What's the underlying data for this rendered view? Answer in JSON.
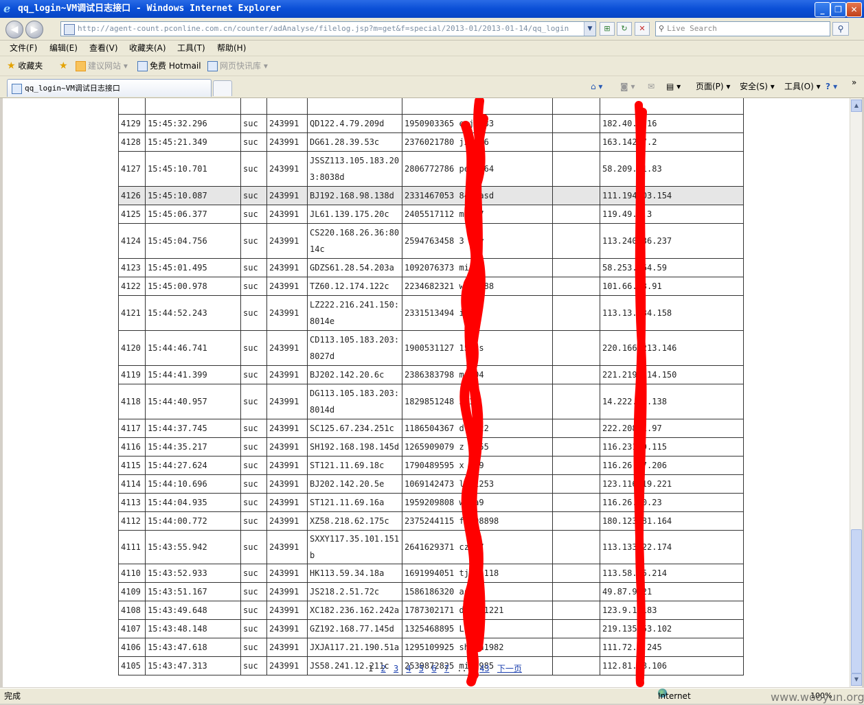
{
  "window": {
    "title": "qq_login~VM调试日志接口 - Windows Internet Explorer",
    "minimize_label": "_",
    "maximize_label": "❐",
    "close_label": "✕"
  },
  "nav": {
    "back_glyph": "◀",
    "forward_glyph": "▶",
    "url": "http://agent-count.pconline.com.cn/counter/adAnalyse/filelog.jsp?m=get&f=special/2013-01/2013-01-14/qq_login",
    "url_dropdown_glyph": "▼",
    "compat_glyph": "⊞",
    "refresh_glyph": "↻",
    "stop_glyph": "✕",
    "search_placeholder": "Live Search",
    "search_glyph": "⚲",
    "search_button_glyph": "⚲"
  },
  "menu": {
    "file": "文件(F)",
    "edit": "编辑(E)",
    "view": "查看(V)",
    "favorites": "收藏夹(A)",
    "tools": "工具(T)",
    "help": "帮助(H)"
  },
  "favbar": {
    "favorites": "收藏夹",
    "suggested_sites": "建议网站 ▾",
    "hotmail": "免费 Hotmail",
    "web_slices": "网页快讯库 ▾"
  },
  "tabs": {
    "active_title": "qq_login~VM调试日志接口"
  },
  "commandbar": {
    "home_glyph": "⌂ ▾",
    "feeds_glyph": "◙ ▾",
    "mail_glyph": "✉",
    "print_glyph": "▤ ▾",
    "page": "页面(P) ▾",
    "safety": "安全(S) ▾",
    "tools": "工具(O) ▾",
    "help_glyph": "? ▾",
    "more_glyph": "»"
  },
  "log": {
    "rows": [
      {
        "id": "4129",
        "time": "15:45:32.296",
        "status": "suc",
        "code": "243991",
        "src": "QD122.4.79.209d",
        "qq": "1950903365 esj  133",
        "blank": "",
        "ip": "182.40.   .16"
      },
      {
        "id": "4128",
        "time": "15:45:21.349",
        "status": "suc",
        "code": "243991",
        "src": "DG61.28.39.53c",
        "qq": "2376021780 jx   676",
        "blank": "",
        "ip": "163.142  7.2"
      },
      {
        "id": "4127",
        "time": "15:45:10.701",
        "status": "suc",
        "code": "243991",
        "src": "JSSZ113.105.183.203:8038d",
        "qq": "2806772786 pe   7564",
        "blank": "",
        "ip": "58.209.  1.83"
      },
      {
        "id": "4126",
        "time": "15:45:10.087",
        "status": "suc",
        "code": "243991",
        "src": "BJ192.168.98.138d",
        "qq": "2331467053 84   7asd",
        "blank": "",
        "ip": "111.194  03.154"
      },
      {
        "id": "4125",
        "time": "15:45:06.377",
        "status": "suc",
        "code": "243991",
        "src": "JL61.139.175.20c",
        "qq": "2405517112 mi   07",
        "blank": "",
        "ip": "119.49.  .3"
      },
      {
        "id": "4124",
        "time": "15:45:04.756",
        "status": "suc",
        "code": "243991",
        "src": "CS220.168.26.36:8014c",
        "qq": "2594763458 3   9zy",
        "blank": "",
        "ip": "113.240  36.237"
      },
      {
        "id": "4123",
        "time": "15:45:01.495",
        "status": "suc",
        "code": "243991",
        "src": "GDZS61.28.54.203a",
        "qq": "1092076373 mi   46",
        "blank": "",
        "ip": "58.253.  64.59"
      },
      {
        "id": "4122",
        "time": "15:45:00.978",
        "status": "suc",
        "code": "243991",
        "src": "TZ60.12.174.122c",
        "qq": "2234682321 w    ma188",
        "blank": "",
        "ip": "101.66.  3.91"
      },
      {
        "id": "4121",
        "time": "15:44:52.243",
        "status": "suc",
        "code": "243991",
        "src": "LZ222.216.241.150:8014e",
        "qq": "2331513494 i   16",
        "blank": "",
        "ip": "113.13.  34.158"
      },
      {
        "id": "4120",
        "time": "15:44:46.741",
        "status": "suc",
        "code": "243991",
        "src": "CD113.105.183.203:8027d",
        "qq": "1900531127 15   cs",
        "blank": "",
        "ip": "220.166  213.146"
      },
      {
        "id": "4119",
        "time": "15:44:41.399",
        "status": "suc",
        "code": "243991",
        "src": "BJ202.142.20.6c",
        "qq": "2386383798 mi   04",
        "blank": "",
        "ip": "221.219  114.150"
      },
      {
        "id": "4118",
        "time": "15:44:40.957",
        "status": "suc",
        "code": "243991",
        "src": "DG113.105.183.203:8014d",
        "qq": "1829851248 3   1a",
        "blank": "",
        "ip": "14.222.  1.138"
      },
      {
        "id": "4117",
        "time": "15:44:37.745",
        "status": "suc",
        "code": "243991",
        "src": "SC125.67.234.251c",
        "qq": "1186504367 d   1222",
        "blank": "",
        "ip": "222.208  1.97"
      },
      {
        "id": "4116",
        "time": "15:44:35.217",
        "status": "suc",
        "code": "243991",
        "src": "SH192.168.198.145d",
        "qq": "1265909079 z   8155",
        "blank": "",
        "ip": "116.231  9.115"
      },
      {
        "id": "4115",
        "time": "15:44:27.624",
        "status": "suc",
        "code": "243991",
        "src": "ST121.11.69.18c",
        "qq": "1790489595 x   629",
        "blank": "",
        "ip": "116.26.  7.206"
      },
      {
        "id": "4114",
        "time": "15:44:10.696",
        "status": "suc",
        "code": "243991",
        "src": "BJ202.142.20.5e",
        "qq": "1069142473 lz   1253",
        "blank": "",
        "ip": "123.116  19.221"
      },
      {
        "id": "4113",
        "time": "15:44:04.935",
        "status": "suc",
        "code": "243991",
        "src": "ST121.11.69.16a",
        "qq": "1959209808 wa   a9",
        "blank": "",
        "ip": "116.26.  0.23"
      },
      {
        "id": "4112",
        "time": "15:44:00.772",
        "status": "suc",
        "code": "243991",
        "src": "XZ58.218.62.175c",
        "qq": "2375244115 fj   98898",
        "blank": "",
        "ip": "180.123  81.164"
      },
      {
        "id": "4111",
        "time": "15:43:55.942",
        "status": "suc",
        "code": "243991",
        "src": "SXXY117.35.101.151b",
        "qq": "2641629371 cz   37",
        "blank": "",
        "ip": "113.133  22.174"
      },
      {
        "id": "4110",
        "time": "15:43:52.933",
        "status": "suc",
        "code": "243991",
        "src": "HK113.59.34.18a",
        "qq": "1691994051 tj   71118",
        "blank": "",
        "ip": "113.58.  5.214"
      },
      {
        "id": "4109",
        "time": "15:43:51.167",
        "status": "suc",
        "code": "243991",
        "src": "JS218.2.51.72c",
        "qq": "1586186320 as   35",
        "blank": "",
        "ip": "49.87.9  21"
      },
      {
        "id": "4108",
        "time": "15:43:49.648",
        "status": "suc",
        "code": "243991",
        "src": "XC182.236.162.242a",
        "qq": "1787302171 da   861221",
        "blank": "",
        "ip": "123.9.1   183"
      },
      {
        "id": "4107",
        "time": "15:43:48.148",
        "status": "suc",
        "code": "243991",
        "src": "GZ192.168.77.145d",
        "qq": "1325468895 LO   56",
        "blank": "",
        "ip": "219.135  53.102"
      },
      {
        "id": "4106",
        "time": "15:43:47.618",
        "status": "suc",
        "code": "243991",
        "src": "JXJA117.21.190.51a",
        "qq": "1295109925 sh   ua1982",
        "blank": "",
        "ip": "111.72.  .245"
      },
      {
        "id": "4105",
        "time": "15:43:47.313",
        "status": "suc",
        "code": "243991",
        "src": "JS58.241.12.211c",
        "qq": "2539872825 mi   6985",
        "blank": "",
        "ip": "112.81.  8.106"
      }
    ]
  },
  "pager": {
    "current": "1",
    "pages": [
      "2",
      "3",
      "4",
      "5",
      "6",
      "7"
    ],
    "ellipsis": "...",
    "last": "43",
    "next": "下一页"
  },
  "scroll": {
    "up_glyph": "▲",
    "down_glyph": "▼"
  },
  "status": {
    "left": "完成",
    "zone": "Internet",
    "zoom": "100%",
    "watermark": "www.wooyun.org"
  },
  "colors": {
    "redaction": "#ff0000",
    "link": "#1a3fae",
    "highlight_row": "#e6e6e6"
  }
}
